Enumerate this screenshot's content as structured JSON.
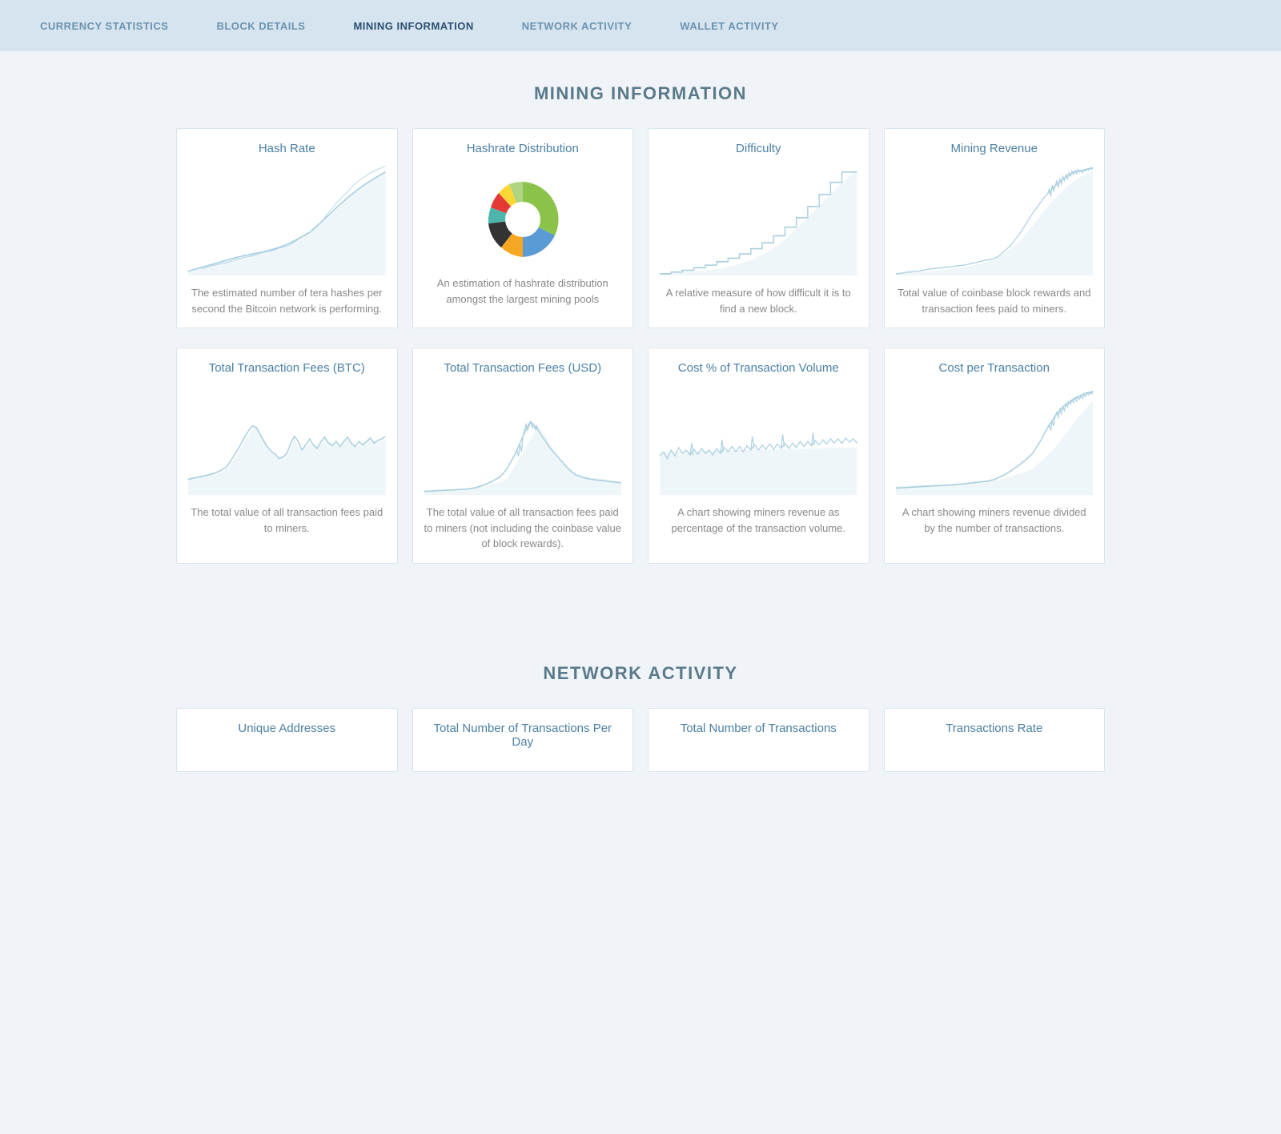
{
  "nav": {
    "items": [
      {
        "label": "CURRENCY STATISTICS",
        "active": false,
        "id": "currency-statistics"
      },
      {
        "label": "BLOCK DETAILS",
        "active": false,
        "id": "block-details"
      },
      {
        "label": "MINING INFORMATION",
        "active": true,
        "id": "mining-information"
      },
      {
        "label": "NETWORK ACTIVITY",
        "active": false,
        "id": "network-activity"
      },
      {
        "label": "WALLET ACTIVITY",
        "active": false,
        "id": "wallet-activity"
      }
    ]
  },
  "mining": {
    "section_title": "MINING INFORMATION",
    "cards_row1": [
      {
        "id": "hash-rate",
        "title": "Hash Rate",
        "description": "The estimated number of tera hashes per second the Bitcoin network is performing.",
        "chart_type": "line_rising"
      },
      {
        "id": "hashrate-distribution",
        "title": "Hashrate Distribution",
        "description": "An estimation of hashrate distribution amongst the largest mining pools",
        "chart_type": "pie"
      },
      {
        "id": "difficulty",
        "title": "Difficulty",
        "description": "A relative measure of how difficult it is to find a new block.",
        "chart_type": "line_steps"
      },
      {
        "id": "mining-revenue",
        "title": "Mining Revenue",
        "description": "Total value of coinbase block rewards and transaction fees paid to miners.",
        "chart_type": "line_rising_volatile"
      }
    ],
    "cards_row2": [
      {
        "id": "total-tx-fees-btc",
        "title": "Total Transaction Fees (BTC)",
        "description": "The total value of all transaction fees paid to miners.",
        "chart_type": "line_volatile"
      },
      {
        "id": "total-tx-fees-usd",
        "title": "Total Transaction Fees (USD)",
        "description": "The total value of all transaction fees paid to miners (not including the coinbase value of block rewards).",
        "chart_type": "line_volatile_peak"
      },
      {
        "id": "cost-pct-volume",
        "title": "Cost % of Transaction Volume",
        "description": "A chart showing miners revenue as percentage of the transaction volume.",
        "chart_type": "line_noisy"
      },
      {
        "id": "cost-per-tx",
        "title": "Cost per Transaction",
        "description": "A chart showing miners revenue divided by the number of transactions.",
        "chart_type": "line_rising_end"
      }
    ]
  },
  "network": {
    "section_title": "NETWORK ACTIVITY",
    "cards": [
      {
        "id": "unique-addresses",
        "title": "Unique Addresses",
        "description": ""
      },
      {
        "id": "total-tx-per-day",
        "title": "Total Number of Transactions Per Day",
        "description": ""
      },
      {
        "id": "total-tx",
        "title": "Total Number of Transactions",
        "description": ""
      },
      {
        "id": "tx-rate",
        "title": "Transactions Rate",
        "description": ""
      }
    ]
  }
}
